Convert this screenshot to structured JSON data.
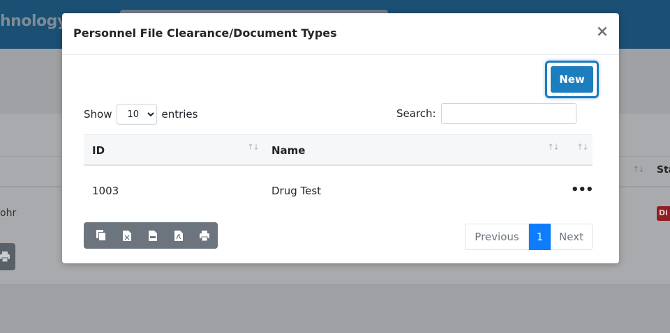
{
  "background": {
    "brand_text": "hnology G",
    "column_label": "Sta",
    "row_text": "ohr",
    "badge_text": "Di",
    "sort_glyph": "↑↓"
  },
  "modal": {
    "title": "Personnel File Clearance/Document Types",
    "close_symbol": "×",
    "new_button": "New",
    "length": {
      "show_label": "Show",
      "selected": "10",
      "entries_label": "entries"
    },
    "search": {
      "label": "Search:",
      "value": ""
    },
    "table": {
      "columns": [
        "ID",
        "Name",
        ""
      ],
      "sort_glyph": "↑↓",
      "rows": [
        {
          "id": "1003",
          "name": "Drug Test",
          "actions": "•••"
        }
      ]
    },
    "export_buttons": [
      {
        "icon": "copy-icon"
      },
      {
        "icon": "excel-icon"
      },
      {
        "icon": "csv-icon"
      },
      {
        "icon": "pdf-icon"
      },
      {
        "icon": "print-icon"
      }
    ],
    "pagination": {
      "previous": "Previous",
      "current": "1",
      "next": "Next"
    }
  },
  "colors": {
    "primary_button": "#1c7ebe",
    "active_page": "#0d7dfd",
    "export_group": "#6c757d",
    "header_bar": "#1b4f73"
  }
}
